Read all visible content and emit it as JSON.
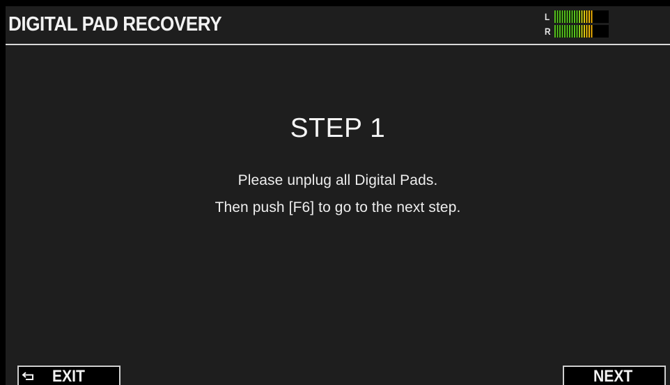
{
  "header": {
    "title": "DIGITAL PAD RECOVERY",
    "level_meter": {
      "left_label": "L",
      "right_label": "R",
      "left_level": 0.72,
      "right_level": 0.72
    }
  },
  "main": {
    "step_heading": "STEP 1",
    "message_line1": "Please unplug all Digital Pads.",
    "message_line2": "Then push [F6] to go to the next step."
  },
  "function_keys": {
    "exit": {
      "label": "EXIT",
      "icon": "return-arrow-icon"
    },
    "next": {
      "label": "NEXT"
    }
  },
  "colors": {
    "background": "#1e1e1e",
    "text": "#f2f2f2",
    "meter_green": "#57c41f",
    "meter_yellow": "#f0c20c"
  }
}
